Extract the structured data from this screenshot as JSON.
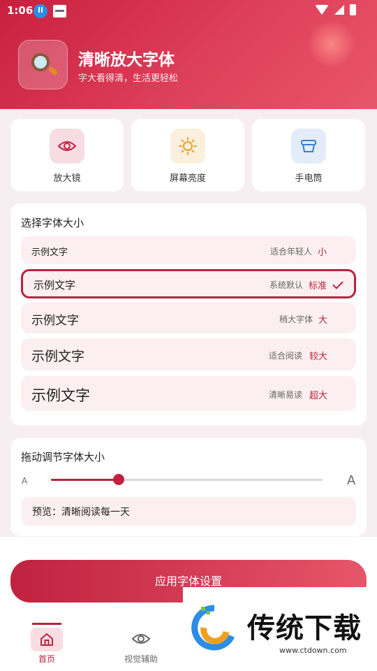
{
  "status": {
    "time": "1:06"
  },
  "header": {
    "title": "清晰放大字体",
    "subtitle": "字大看得清，生活更轻松"
  },
  "tools": [
    {
      "label": "放大镜",
      "icon": "eye-icon",
      "color": "#c8203f",
      "bg": "#f7dde3"
    },
    {
      "label": "屏幕亮度",
      "icon": "sun-icon",
      "color": "#e8a224",
      "bg": "#fbf0dd"
    },
    {
      "label": "手电筒",
      "icon": "flashlight-icon",
      "color": "#3a7fd1",
      "bg": "#e3edf9"
    }
  ],
  "font_size": {
    "title": "选择字体大小",
    "options": [
      {
        "sample": "示例文字",
        "desc": "适合年轻人",
        "level": "小"
      },
      {
        "sample": "示例文字",
        "desc": "系统默认",
        "level": "标准",
        "selected": true
      },
      {
        "sample": "示例文字",
        "desc": "稍大字体",
        "level": "大"
      },
      {
        "sample": "示例文字",
        "desc": "适合阅读",
        "level": "较大"
      },
      {
        "sample": "示例文字",
        "desc": "清晰易读",
        "level": "超大"
      }
    ]
  },
  "slider": {
    "title": "拖动调节字体大小",
    "min_label": "A",
    "max_label": "A",
    "value_fraction": 0.25,
    "preview": "预览：清晰阅读每一天"
  },
  "apply_label": "应用字体设置",
  "nav": [
    {
      "label": "首页",
      "icon": "home-icon",
      "active": true
    },
    {
      "label": "视觉辅助",
      "icon": "eye-icon",
      "active": false
    }
  ],
  "watermark": {
    "brand": "传统下载",
    "url": "www.ctdown.com"
  },
  "colors": {
    "accent": "#b8233f",
    "header_start": "#c8203f",
    "header_end": "#e8556a"
  }
}
